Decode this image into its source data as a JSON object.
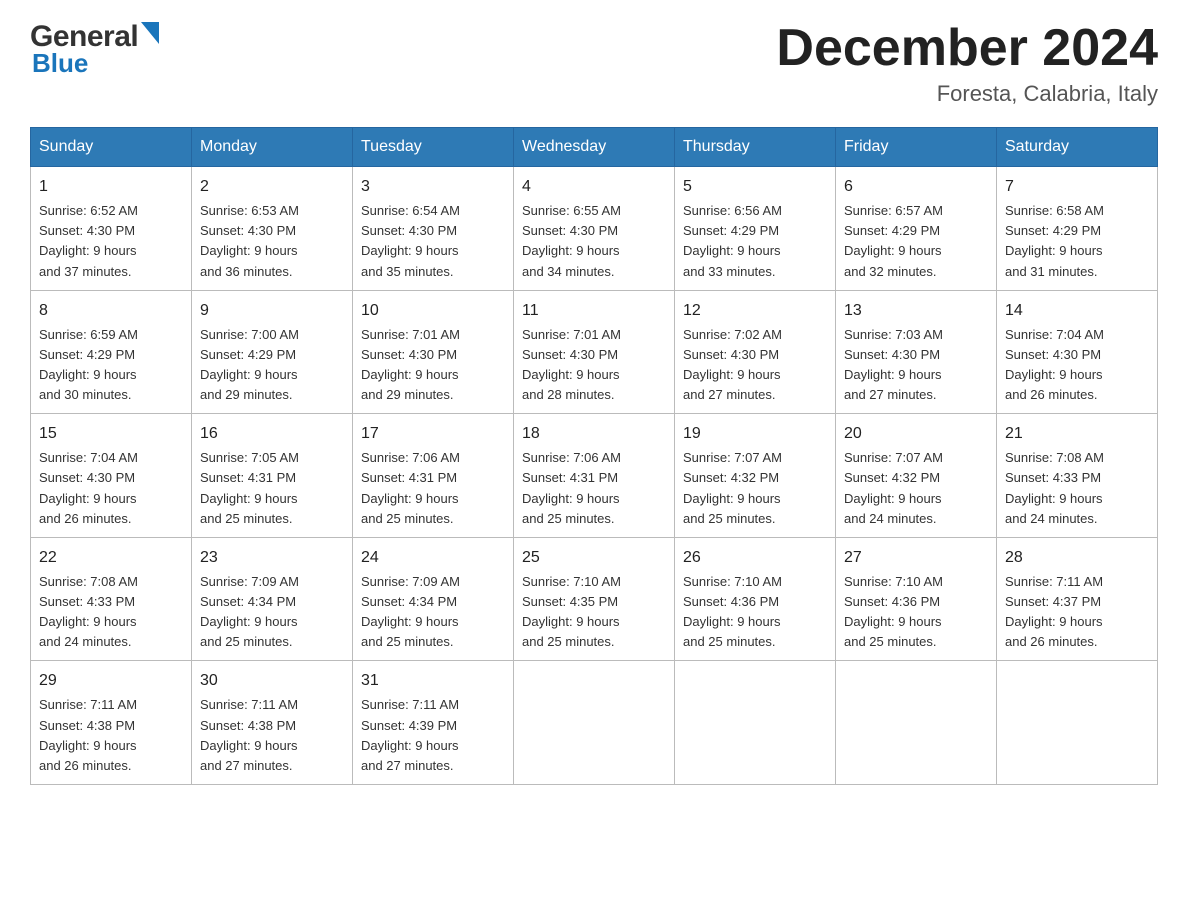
{
  "header": {
    "logo_general": "General",
    "logo_blue": "Blue",
    "month_title": "December 2024",
    "location": "Foresta, Calabria, Italy"
  },
  "days_of_week": [
    "Sunday",
    "Monday",
    "Tuesday",
    "Wednesday",
    "Thursday",
    "Friday",
    "Saturday"
  ],
  "weeks": [
    [
      {
        "day": "1",
        "sunrise": "6:52 AM",
        "sunset": "4:30 PM",
        "daylight": "9 hours and 37 minutes."
      },
      {
        "day": "2",
        "sunrise": "6:53 AM",
        "sunset": "4:30 PM",
        "daylight": "9 hours and 36 minutes."
      },
      {
        "day": "3",
        "sunrise": "6:54 AM",
        "sunset": "4:30 PM",
        "daylight": "9 hours and 35 minutes."
      },
      {
        "day": "4",
        "sunrise": "6:55 AM",
        "sunset": "4:30 PM",
        "daylight": "9 hours and 34 minutes."
      },
      {
        "day": "5",
        "sunrise": "6:56 AM",
        "sunset": "4:29 PM",
        "daylight": "9 hours and 33 minutes."
      },
      {
        "day": "6",
        "sunrise": "6:57 AM",
        "sunset": "4:29 PM",
        "daylight": "9 hours and 32 minutes."
      },
      {
        "day": "7",
        "sunrise": "6:58 AM",
        "sunset": "4:29 PM",
        "daylight": "9 hours and 31 minutes."
      }
    ],
    [
      {
        "day": "8",
        "sunrise": "6:59 AM",
        "sunset": "4:29 PM",
        "daylight": "9 hours and 30 minutes."
      },
      {
        "day": "9",
        "sunrise": "7:00 AM",
        "sunset": "4:29 PM",
        "daylight": "9 hours and 29 minutes."
      },
      {
        "day": "10",
        "sunrise": "7:01 AM",
        "sunset": "4:30 PM",
        "daylight": "9 hours and 29 minutes."
      },
      {
        "day": "11",
        "sunrise": "7:01 AM",
        "sunset": "4:30 PM",
        "daylight": "9 hours and 28 minutes."
      },
      {
        "day": "12",
        "sunrise": "7:02 AM",
        "sunset": "4:30 PM",
        "daylight": "9 hours and 27 minutes."
      },
      {
        "day": "13",
        "sunrise": "7:03 AM",
        "sunset": "4:30 PM",
        "daylight": "9 hours and 27 minutes."
      },
      {
        "day": "14",
        "sunrise": "7:04 AM",
        "sunset": "4:30 PM",
        "daylight": "9 hours and 26 minutes."
      }
    ],
    [
      {
        "day": "15",
        "sunrise": "7:04 AM",
        "sunset": "4:30 PM",
        "daylight": "9 hours and 26 minutes."
      },
      {
        "day": "16",
        "sunrise": "7:05 AM",
        "sunset": "4:31 PM",
        "daylight": "9 hours and 25 minutes."
      },
      {
        "day": "17",
        "sunrise": "7:06 AM",
        "sunset": "4:31 PM",
        "daylight": "9 hours and 25 minutes."
      },
      {
        "day": "18",
        "sunrise": "7:06 AM",
        "sunset": "4:31 PM",
        "daylight": "9 hours and 25 minutes."
      },
      {
        "day": "19",
        "sunrise": "7:07 AM",
        "sunset": "4:32 PM",
        "daylight": "9 hours and 25 minutes."
      },
      {
        "day": "20",
        "sunrise": "7:07 AM",
        "sunset": "4:32 PM",
        "daylight": "9 hours and 24 minutes."
      },
      {
        "day": "21",
        "sunrise": "7:08 AM",
        "sunset": "4:33 PM",
        "daylight": "9 hours and 24 minutes."
      }
    ],
    [
      {
        "day": "22",
        "sunrise": "7:08 AM",
        "sunset": "4:33 PM",
        "daylight": "9 hours and 24 minutes."
      },
      {
        "day": "23",
        "sunrise": "7:09 AM",
        "sunset": "4:34 PM",
        "daylight": "9 hours and 25 minutes."
      },
      {
        "day": "24",
        "sunrise": "7:09 AM",
        "sunset": "4:34 PM",
        "daylight": "9 hours and 25 minutes."
      },
      {
        "day": "25",
        "sunrise": "7:10 AM",
        "sunset": "4:35 PM",
        "daylight": "9 hours and 25 minutes."
      },
      {
        "day": "26",
        "sunrise": "7:10 AM",
        "sunset": "4:36 PM",
        "daylight": "9 hours and 25 minutes."
      },
      {
        "day": "27",
        "sunrise": "7:10 AM",
        "sunset": "4:36 PM",
        "daylight": "9 hours and 25 minutes."
      },
      {
        "day": "28",
        "sunrise": "7:11 AM",
        "sunset": "4:37 PM",
        "daylight": "9 hours and 26 minutes."
      }
    ],
    [
      {
        "day": "29",
        "sunrise": "7:11 AM",
        "sunset": "4:38 PM",
        "daylight": "9 hours and 26 minutes."
      },
      {
        "day": "30",
        "sunrise": "7:11 AM",
        "sunset": "4:38 PM",
        "daylight": "9 hours and 27 minutes."
      },
      {
        "day": "31",
        "sunrise": "7:11 AM",
        "sunset": "4:39 PM",
        "daylight": "9 hours and 27 minutes."
      },
      null,
      null,
      null,
      null
    ]
  ],
  "labels": {
    "sunrise": "Sunrise:",
    "sunset": "Sunset:",
    "daylight": "Daylight:"
  }
}
